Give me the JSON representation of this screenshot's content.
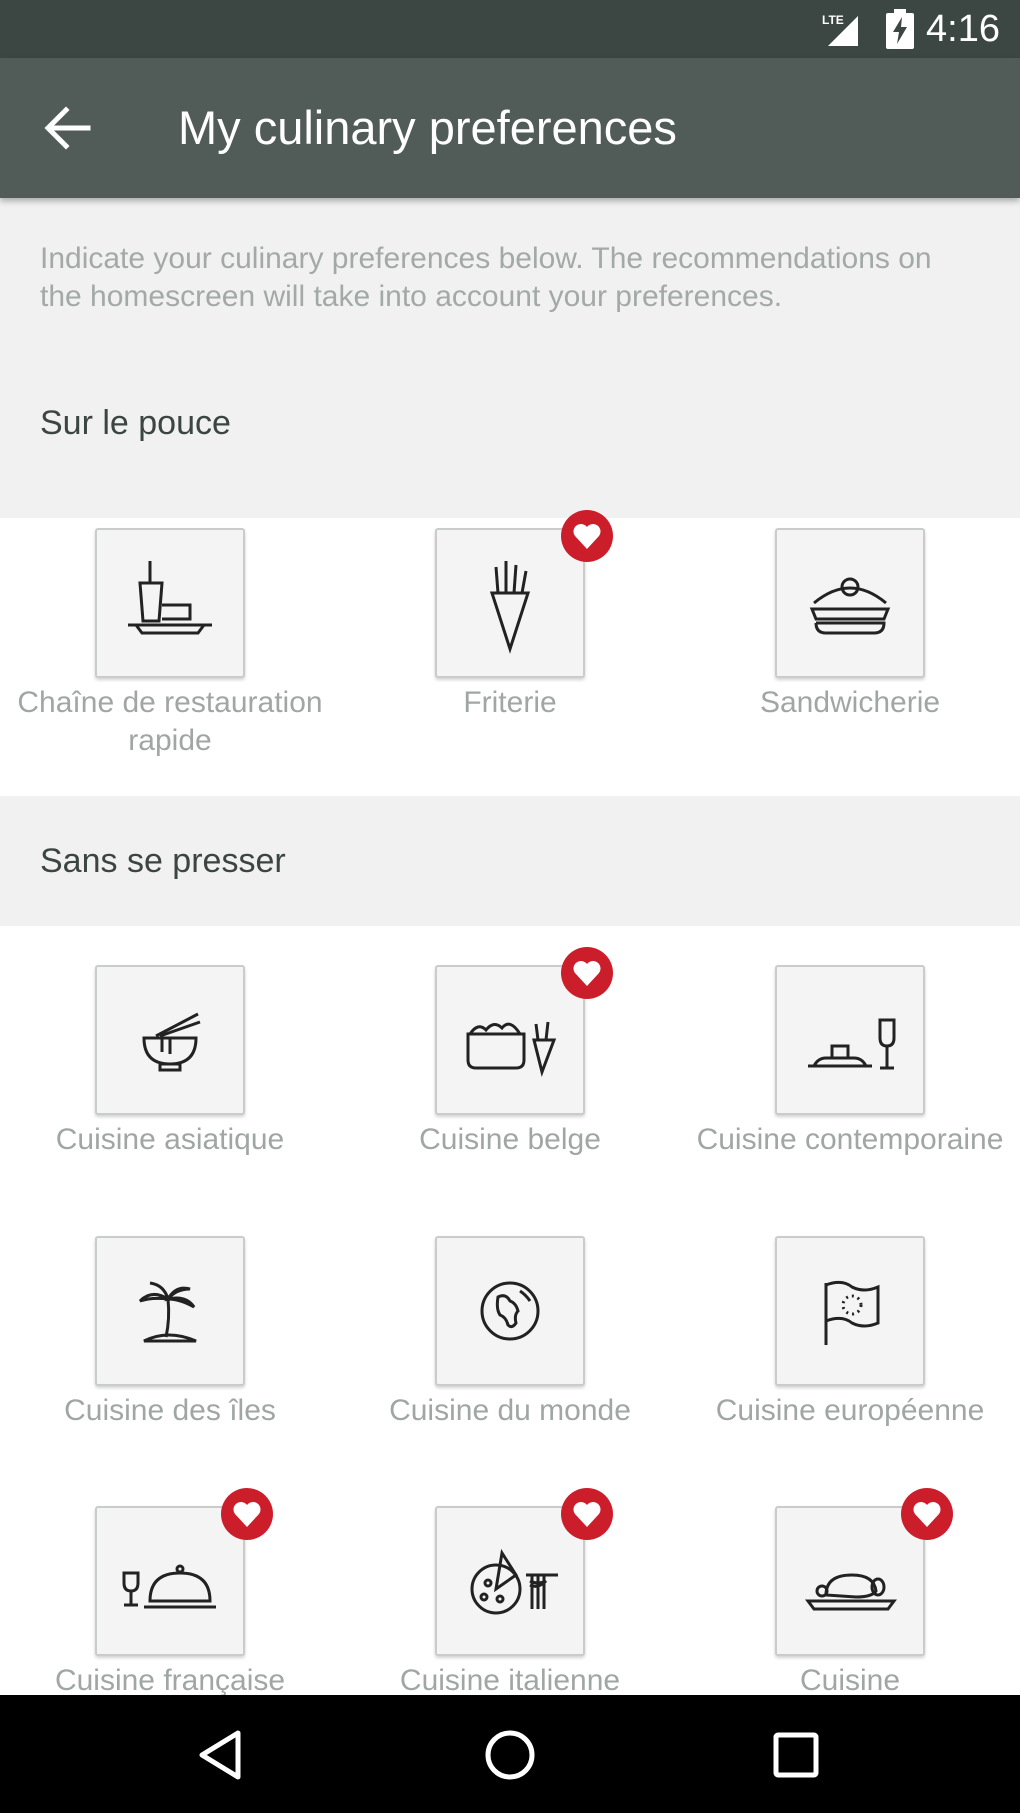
{
  "status_bar": {
    "time": "4:16",
    "network": "LTE"
  },
  "app_bar": {
    "title": "My culinary preferences",
    "back_icon": "arrow-left-icon"
  },
  "intro": "Indicate your culinary preferences below. The recommendations on the homescreen will take into account your preferences.",
  "sections": [
    {
      "title": "Sur le pouce",
      "items": [
        {
          "label": "Chaîne de restauration rapide",
          "icon": "fast-food-tray-icon",
          "favorite": false
        },
        {
          "label": "Friterie",
          "icon": "fries-cone-icon",
          "favorite": true
        },
        {
          "label": "Sandwicherie",
          "icon": "sandwich-icon",
          "favorite": false
        }
      ]
    },
    {
      "title": "Sans se presser",
      "items": [
        {
          "label": "Cuisine asiatique",
          "icon": "noodle-bowl-icon",
          "favorite": false
        },
        {
          "label": "Cuisine belge",
          "icon": "mussels-pot-fries-icon",
          "favorite": true
        },
        {
          "label": "Cuisine contemporaine",
          "icon": "plated-dish-glass-icon",
          "favorite": false
        },
        {
          "label": "Cuisine des îles",
          "icon": "palm-island-icon",
          "favorite": false
        },
        {
          "label": "Cuisine du monde",
          "icon": "globe-icon",
          "favorite": false
        },
        {
          "label": "Cuisine européenne",
          "icon": "eu-flag-icon",
          "favorite": false
        },
        {
          "label": "Cuisine française",
          "icon": "cloche-wine-icon",
          "favorite": true
        },
        {
          "label": "Cuisine italienne",
          "icon": "pizza-pasta-icon",
          "favorite": true
        },
        {
          "label": "Cuisine",
          "icon": "roast-platter-icon",
          "favorite": true
        }
      ]
    }
  ],
  "colors": {
    "accent": "#cc1d2b",
    "app_bar": "#515c59",
    "status_bar": "#3c4744"
  },
  "nav_bar": {
    "back": "nav-back-icon",
    "home": "nav-home-icon",
    "recents": "nav-recents-icon"
  }
}
